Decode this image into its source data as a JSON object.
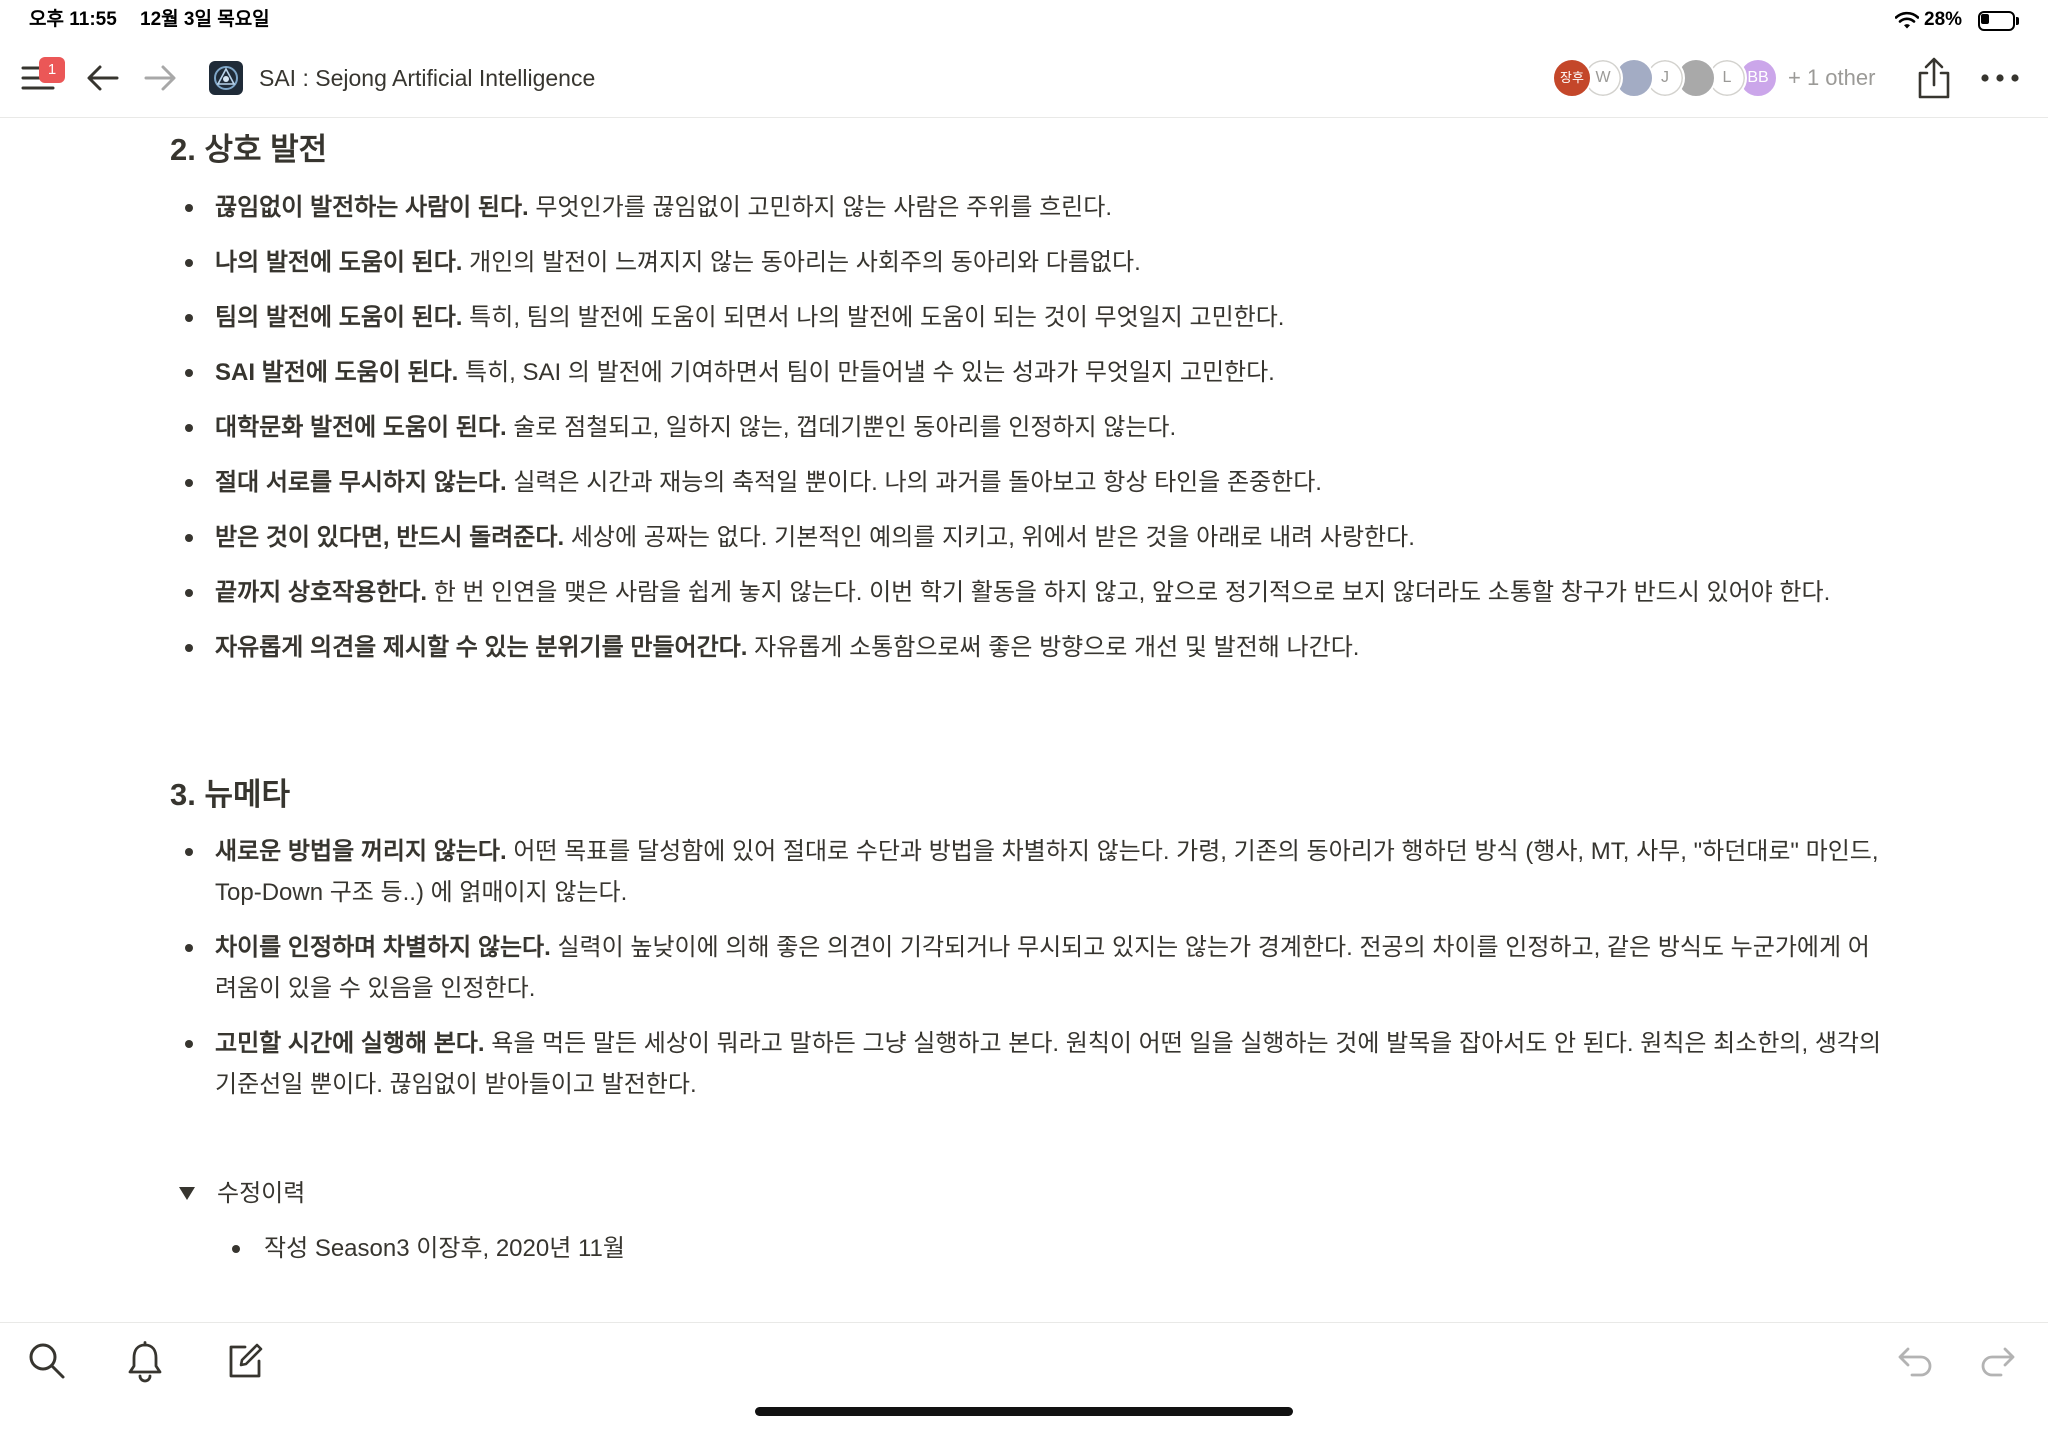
{
  "status_bar": {
    "time": "오후 11:55",
    "date": "12월 3일 목요일",
    "battery_percent": "28%",
    "battery_level": 0.28
  },
  "toolbar": {
    "notification_badge": "1",
    "page_title": "SAI : Sejong Artificial Intelligence",
    "collaborators": [
      {
        "initials": "장후",
        "color": "#c4472a"
      },
      {
        "initials": "W",
        "color": "#ffffff"
      },
      {
        "initials": "",
        "color": "#a3acc4"
      },
      {
        "initials": "J",
        "color": "#ffffff"
      },
      {
        "initials": "",
        "color": "#a9a9a9"
      },
      {
        "initials": "L",
        "color": "#ffffff"
      },
      {
        "initials": "BB",
        "color": "#cba6ea"
      }
    ],
    "others_label": "+ 1 other"
  },
  "sections": [
    {
      "heading": "2. 상호 발전",
      "items": [
        {
          "bold": "끊임없이 발전하는 사람이 된다.",
          "text": "무엇인가를 끊임없이 고민하지 않는 사람은 주위를 흐린다."
        },
        {
          "bold": "나의 발전에 도움이 된다.",
          "text": "개인의 발전이 느껴지지 않는 동아리는 사회주의 동아리와 다름없다."
        },
        {
          "bold": "팀의 발전에 도움이 된다.",
          "text": "특히, 팀의 발전에 도움이 되면서 나의 발전에 도움이 되는 것이 무엇일지 고민한다."
        },
        {
          "bold": "SAI 발전에 도움이 된다.",
          "text": "특히, SAI 의 발전에 기여하면서 팀이 만들어낼 수 있는 성과가 무엇일지 고민한다."
        },
        {
          "bold": "대학문화 발전에 도움이 된다.",
          "text": "술로 점철되고, 일하지 않는, 껍데기뿐인 동아리를 인정하지 않는다."
        },
        {
          "bold": "절대 서로를 무시하지 않는다.",
          "text": "실력은 시간과 재능의 축적일 뿐이다. 나의 과거를 돌아보고 항상 타인을 존중한다."
        },
        {
          "bold": "받은 것이 있다면, 반드시 돌려준다.",
          "text": "세상에 공짜는 없다. 기본적인 예의를 지키고, 위에서 받은 것을 아래로 내려 사랑한다."
        },
        {
          "bold": "끝까지 상호작용한다.",
          "text": "한 번 인연을 맺은 사람을 쉽게 놓지 않는다. 이번 학기 활동을 하지 않고, 앞으로 정기적으로 보지 않더라도 소통할 창구가 반드시 있어야 한다."
        },
        {
          "bold": "자유롭게 의견을 제시할 수 있는 분위기를 만들어간다.",
          "text": "자유롭게 소통함으로써 좋은 방향으로 개선 및 발전해 나간다."
        }
      ]
    },
    {
      "heading": "3. 뉴메타",
      "items": [
        {
          "bold": "새로운 방법을 꺼리지 않는다.",
          "text": "어떤 목표를 달성함에 있어 절대로 수단과 방법을 차별하지 않는다. 가령, 기존의 동아리가 행하던 방식 (행사, MT, 사무, \"하던대로\" 마인드, Top-Down 구조 등..) 에 얽매이지 않는다."
        },
        {
          "bold": "차이를 인정하며 차별하지 않는다.",
          "text": "실력이 높낮이에 의해 좋은 의견이 기각되거나 무시되고 있지는 않는가 경계한다. 전공의 차이를 인정하고, 같은 방식도 누군가에게 어려움이 있을 수 있음을 인정한다."
        },
        {
          "bold": "고민할 시간에 실행해 본다.",
          "text": "욕을 먹든 말든 세상이 뭐라고 말하든 그냥 실행하고 본다. 원칙이 어떤 일을 실행하는 것에 발목을 잡아서도 안 된다. 원칙은 최소한의, 생각의 기준선일 뿐이다. 끊임없이 받아들이고 발전한다."
        }
      ]
    }
  ],
  "toggle": {
    "label": "수정이력",
    "expanded": true,
    "items": [
      "작성 Season3 이장후, 2020년 11월"
    ]
  },
  "icons": {
    "status": [
      "wifi-icon",
      "battery-icon"
    ],
    "toolbar": [
      "menu-icon",
      "back-arrow-icon",
      "forward-arrow-icon",
      "page-icon",
      "share-icon",
      "more-icon"
    ],
    "bottom": [
      "search-icon",
      "bell-icon",
      "compose-icon",
      "undo-icon",
      "redo-icon"
    ]
  },
  "theme": {
    "text": "#37352f",
    "badge": "#eb5757",
    "muted": "#9b9a97",
    "disabled": "#b3b3b3"
  }
}
